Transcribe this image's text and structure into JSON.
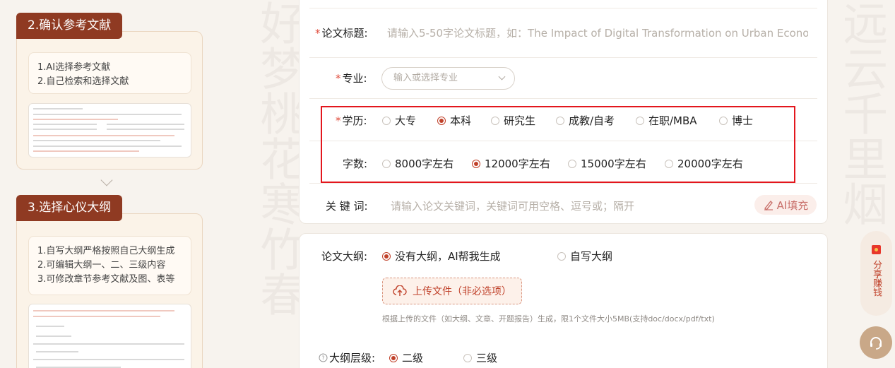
{
  "steps": [
    {
      "title": "2.确认参考文献",
      "lines": [
        "1.AI选择参考文献",
        "2.自己检索和选择文献"
      ]
    },
    {
      "title": "3.选择心仪大纲",
      "lines": [
        "1.自写大纲严格按照自己大纲生成",
        "2.可编辑大纲一、二、三级内容",
        "3.可修改章节参考文献及图、表等"
      ]
    }
  ],
  "form": {
    "title_label": "论文标题:",
    "title_placeholder": "请输入5-50字论文标题，如：The Impact of Digital Transformation on Urban Economic Gr",
    "major_label": "专业:",
    "major_placeholder": "输入或选择专业",
    "degree_label": "学历:",
    "degree_options": [
      "大专",
      "本科",
      "研究生",
      "成教/自考",
      "在职/MBA",
      "博士"
    ],
    "degree_selected": "本科",
    "words_label": "字数:",
    "words_options": [
      "8000字左右",
      "12000字左右",
      "15000字左右",
      "20000字左右"
    ],
    "words_selected": "12000字左右",
    "keywords_label": "关 键 词:",
    "keywords_placeholder": "请输入论文关键词，关键词可用空格、逗号或；隔开",
    "ai_fill": "AI填充",
    "outline_label": "论文大纲:",
    "outline_options": [
      "没有大纲，AI帮我生成",
      "自写大纲"
    ],
    "outline_selected": "没有大纲，AI帮我生成",
    "upload_label": "上传文件（非必选项）",
    "upload_hint": "根据上传的文件（如大纲、文章、开题报告）生成，限1个文件大小5MB(支持doc/docx/pdf/txt)",
    "level_label": "大纲层级:",
    "level_options": [
      "二级",
      "三级"
    ],
    "level_selected": "二级"
  },
  "side": {
    "share_label": "分享赚钱"
  },
  "colors": {
    "accent": "#c0412a",
    "step_title_bg": "#8f3a22",
    "highlight": "#e3161d"
  },
  "icons": [
    "upload-cloud-icon",
    "ai-pen-icon",
    "gift-icon",
    "headset-icon",
    "chevron-down-icon",
    "question-icon"
  ]
}
